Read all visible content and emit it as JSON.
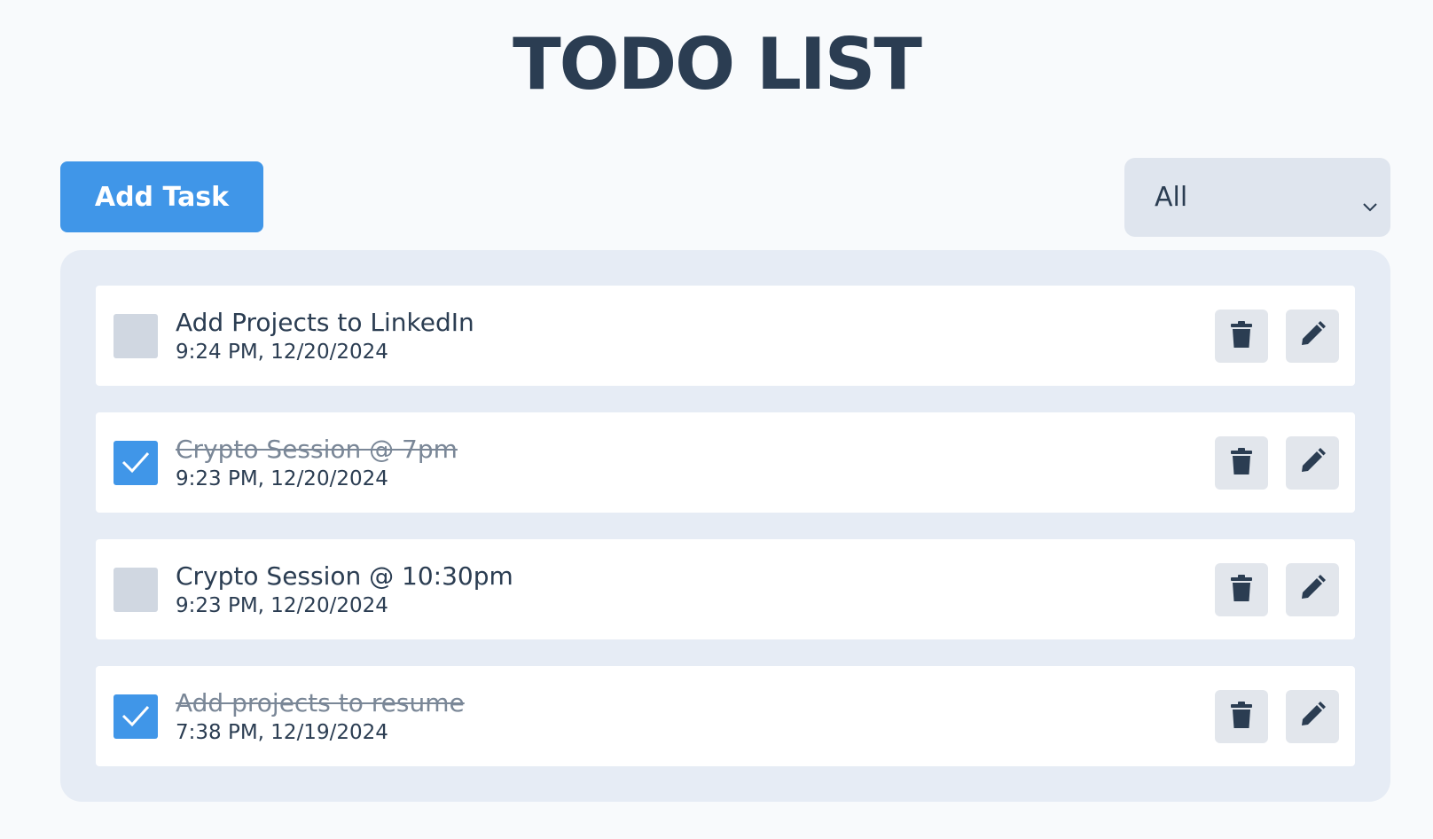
{
  "header": {
    "title": "TODO LIST"
  },
  "toolbar": {
    "add_task_label": "Add Task",
    "filter": {
      "selected": "All",
      "icon": "chevron-down-icon"
    }
  },
  "colors": {
    "accent": "#4096e8",
    "text": "#2b3d52",
    "panel": "#e6ecf5",
    "completed_text": "#7a8797"
  },
  "tasks": [
    {
      "title": "Add Projects to LinkedIn",
      "time": "9:24 PM, 12/20/2024",
      "completed": false
    },
    {
      "title": "Crypto Session @ 7pm",
      "time": "9:23 PM, 12/20/2024",
      "completed": true
    },
    {
      "title": "Crypto Session @ 10:30pm",
      "time": "9:23 PM, 12/20/2024",
      "completed": false
    },
    {
      "title": "Add projects to resume",
      "time": "7:38 PM, 12/19/2024",
      "completed": true
    }
  ],
  "task_actions": {
    "delete_icon": "trash-icon",
    "edit_icon": "pencil-icon"
  }
}
